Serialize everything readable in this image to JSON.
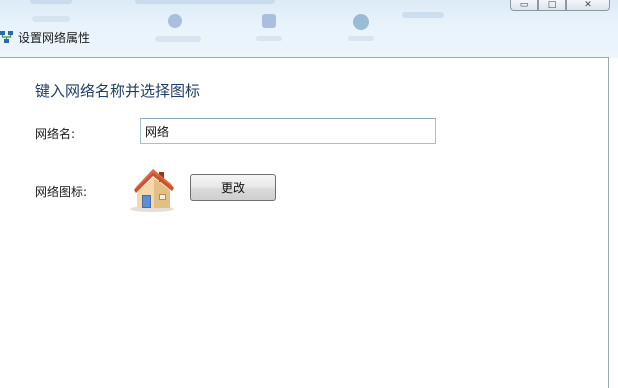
{
  "window": {
    "title": "设置网络属性",
    "controls": {
      "minimize": "▭",
      "maximize": "□",
      "close": "✕"
    }
  },
  "form": {
    "heading": "键入网络名称并选择图标",
    "name_label": "网络名:",
    "name_value": "网络",
    "icon_label": "网络图标:",
    "change_button": "更改"
  },
  "icons": {
    "title_icon": "network-icon",
    "network_icon": "house-icon"
  },
  "colors": {
    "heading": "#1e3f66",
    "aero_background": "#dcebf7"
  }
}
